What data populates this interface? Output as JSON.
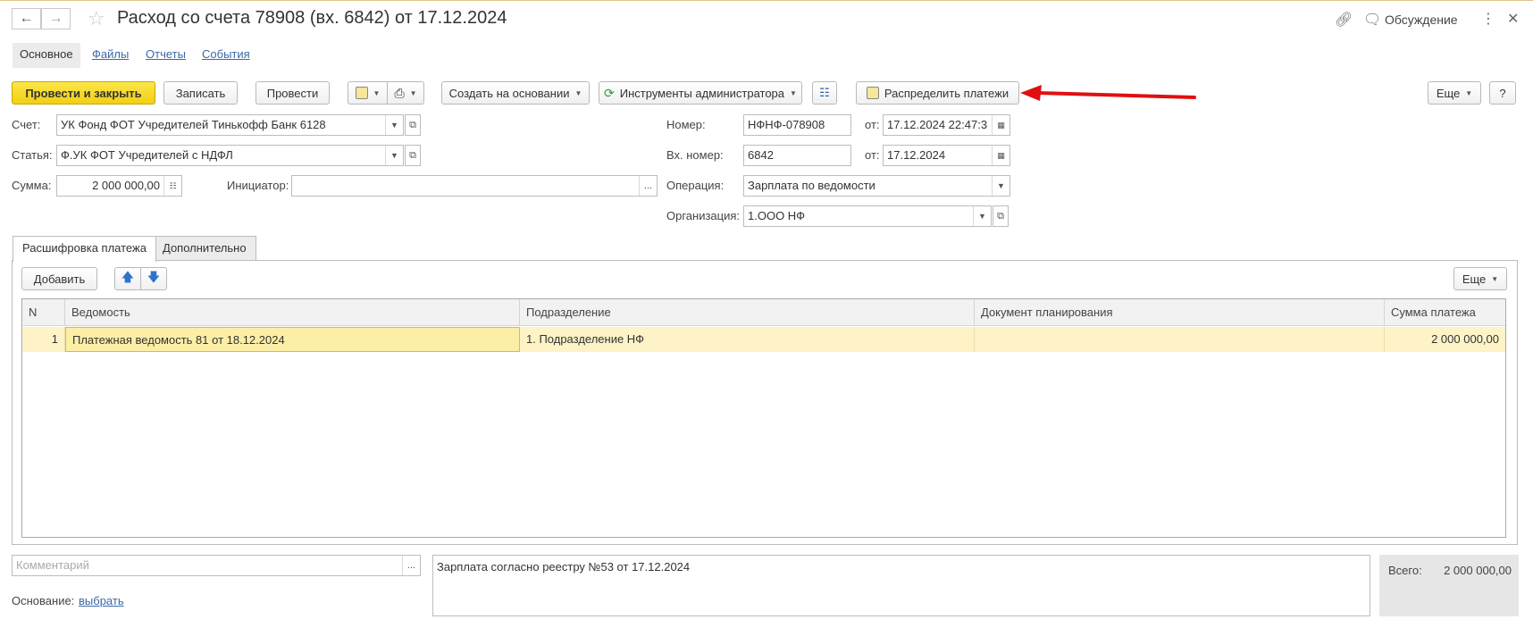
{
  "window": {
    "title": "Расход со счета 78908 (вх. 6842) от 17.12.2024",
    "discussion_label": "Обсуждение"
  },
  "section_tabs": [
    "Основное",
    "Файлы",
    "Отчеты",
    "События"
  ],
  "toolbar": {
    "post_and_close": "Провести и закрыть",
    "save": "Записать",
    "post": "Провести",
    "create_based_on": "Создать на основании",
    "admin_tools": "Инструменты администратора",
    "distribute_payments": "Распределить платежи",
    "more": "Еще",
    "help": "?"
  },
  "form": {
    "account_label": "Счет:",
    "account_value": "УК Фонд ФОТ Учредителей Тинькофф Банк 6128",
    "article_label": "Статья:",
    "article_value": "Ф.УК ФОТ Учредителей с НДФЛ",
    "amount_label": "Сумма:",
    "amount_value": "2 000 000,00",
    "initiator_label": "Инициатор:",
    "initiator_value": "",
    "number_label": "Номер:",
    "number_value": "НФНФ-078908",
    "date_label": "от:",
    "date_value": "17.12.2024 22:47:3",
    "in_number_label": "Вх. номер:",
    "in_number_value": "6842",
    "in_date_label": "от:",
    "in_date_value": "17.12.2024",
    "operation_label": "Операция:",
    "operation_value": "Зарплата по ведомости",
    "org_label": "Организация:",
    "org_value": "1.ООО НФ"
  },
  "tabs": [
    "Расшифровка платежа",
    "Дополнительно"
  ],
  "table_toolbar": {
    "add": "Добавить",
    "more": "Еще"
  },
  "table": {
    "columns": [
      "N",
      "Ведомость",
      "Подразделение",
      "Документ планирования",
      "Сумма платежа"
    ],
    "rows": [
      [
        "1",
        "Платежная ведомость 81 от 18.12.2024",
        "1. Подразделение НФ",
        "",
        "2 000 000,00"
      ]
    ]
  },
  "footer": {
    "comment_placeholder": "Комментарий",
    "memo": "Зарплата согласно реестру №53 от 17.12.2024",
    "basis_label": "Основание:",
    "basis_link": "выбрать",
    "total_label": "Всего:",
    "total_value": "2 000 000,00"
  },
  "colors": {
    "primary_button": "#f2cf12",
    "selected_row": "#fdf3c6",
    "annotation_arrow": "#e01010",
    "link": "#3a6aa8"
  }
}
